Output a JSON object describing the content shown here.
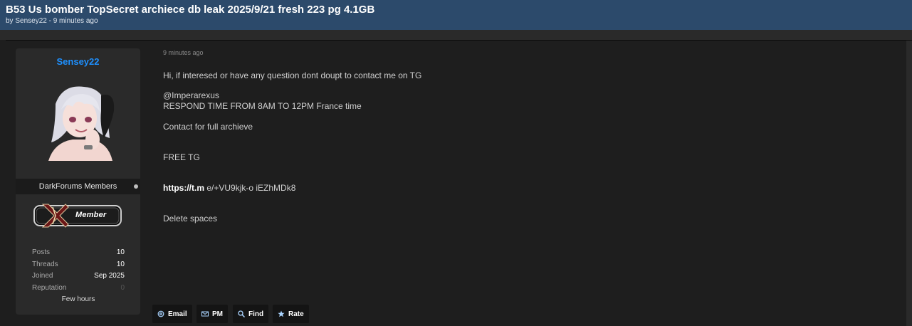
{
  "thread": {
    "title": "B53 Us bomber TopSecret archiece db leak 2025/9/21 fresh 223 pg 4.1GB",
    "meta": "by Sensey22 - 9 minutes ago"
  },
  "author": {
    "username": "Sensey22",
    "group": "DarkForums Members",
    "rank": "Member",
    "stats": [
      {
        "label": "Posts",
        "value": "10"
      },
      {
        "label": "Threads",
        "value": "10"
      },
      {
        "label": "Joined",
        "value": "Sep 2025"
      },
      {
        "label": "Reputation",
        "value": "0"
      }
    ],
    "last_seen": "Few hours"
  },
  "post": {
    "time": "9 minutes ago",
    "lines": [
      "Hi, if interesed or have any question dont doupt to contact me on TG",
      "@Imperarexus",
      "RESPOND TIME FROM 8AM TO 12PM France time",
      "Contact for full archieve",
      "FREE TG",
      "Delete spaces"
    ],
    "link_bold": "https://t.m",
    "link_rest": " e/+VU9kjk-o iEZhMDk8"
  },
  "actions": {
    "email": "Email",
    "pm": "PM",
    "find": "Find",
    "rate": "Rate"
  },
  "colors": {
    "header_bg": "#2c4a6b",
    "username": "#1e90ff",
    "page_bg": "#1e1e1e",
    "card_bg": "#2a2a2a"
  }
}
